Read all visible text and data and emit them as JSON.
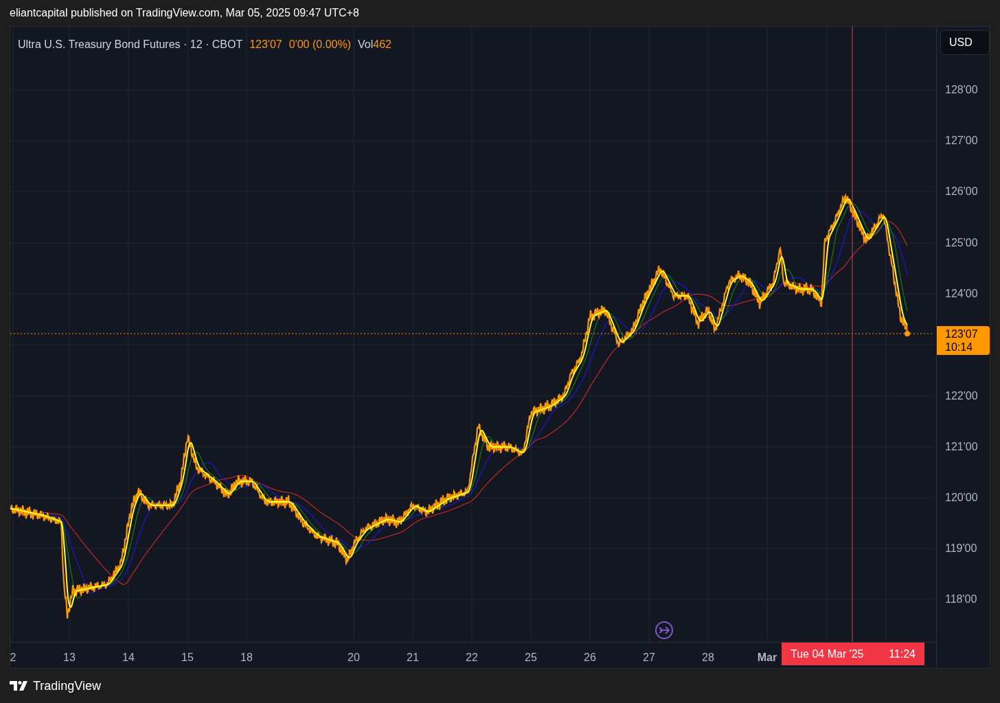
{
  "header": {
    "text": "eliantcapital published on TradingView.com, Mar 05, 2025 09:47 UTC+8"
  },
  "legend": {
    "symbol": "Ultra U.S. Treasury Bond Futures · 12 · CBOT",
    "price": "123'07",
    "change": "0'00 (0.00%)",
    "volume_label": "Vol",
    "volume": "462"
  },
  "currency_button": "USD",
  "price_axis": [
    "128'00",
    "127'00",
    "126'00",
    "125'00",
    "124'00",
    "122'00",
    "121'00",
    "120'00",
    "119'00",
    "118'00"
  ],
  "last_price_tag": {
    "price": "123'07",
    "countdown": "10:14"
  },
  "time_axis": [
    {
      "label": "2",
      "kind": "day"
    },
    {
      "label": "13",
      "kind": "day"
    },
    {
      "label": "14",
      "kind": "day"
    },
    {
      "label": "15",
      "kind": "day"
    },
    {
      "label": "18",
      "kind": "day"
    },
    {
      "label": "20",
      "kind": "day"
    },
    {
      "label": "21",
      "kind": "day"
    },
    {
      "label": "22",
      "kind": "day"
    },
    {
      "label": "25",
      "kind": "day"
    },
    {
      "label": "26",
      "kind": "day"
    },
    {
      "label": "27",
      "kind": "day"
    },
    {
      "label": "28",
      "kind": "day"
    },
    {
      "label": "Mar",
      "kind": "month"
    }
  ],
  "crosshair_label": {
    "date": "Tue 04 Mar '25",
    "time": "11:24"
  },
  "footer": {
    "logo_text": "TradingView"
  }
}
